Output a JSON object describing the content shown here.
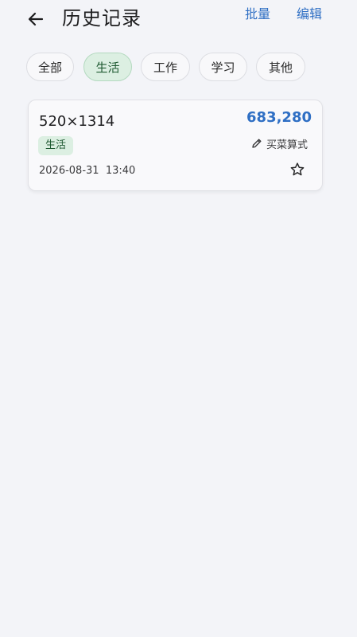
{
  "header": {
    "title": "历史记录",
    "back_icon": "arrow-left-icon",
    "batch_label": "批量",
    "edit_label": "编辑",
    "accent_color": "#2f6fc4"
  },
  "filters": {
    "chips": [
      {
        "label": "全部",
        "active": false
      },
      {
        "label": "生活",
        "active": true
      },
      {
        "label": "工作",
        "active": false
      },
      {
        "label": "学习",
        "active": false
      },
      {
        "label": "其他",
        "active": false
      }
    ],
    "active_color": "#dcefe2"
  },
  "records": [
    {
      "expression": "520×1314",
      "result": "683,280",
      "tag": "生活",
      "note": "买菜算式",
      "note_icon": "pencil-icon",
      "time": "2026-08-31  13:40",
      "favorite_icon": "star-outline-icon",
      "favorited": false
    }
  ]
}
